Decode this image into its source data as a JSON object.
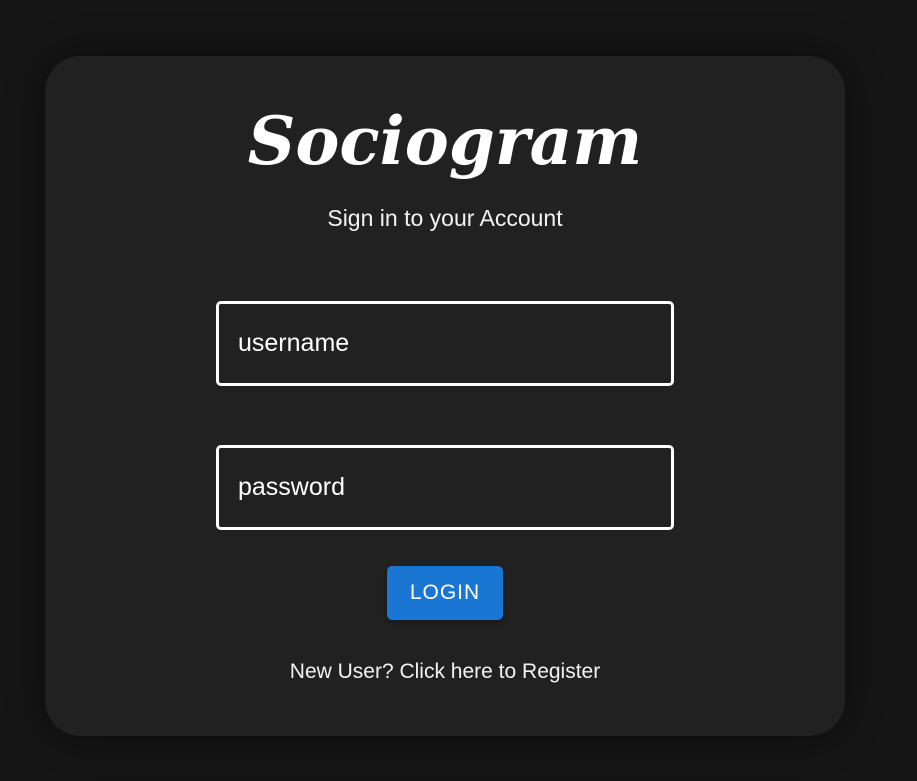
{
  "app": {
    "logo_text": "Sociogram",
    "subtitle": "Sign in to your Account"
  },
  "form": {
    "username": {
      "value": "",
      "placeholder": "username"
    },
    "password": {
      "value": "",
      "placeholder": "password"
    },
    "login_label": "LOGIN",
    "register_link": "New User? Click here to Register"
  },
  "colors": {
    "page_background": "#151515",
    "card_background": "#212121",
    "text": "#ffffff",
    "accent": "#1976d2"
  }
}
